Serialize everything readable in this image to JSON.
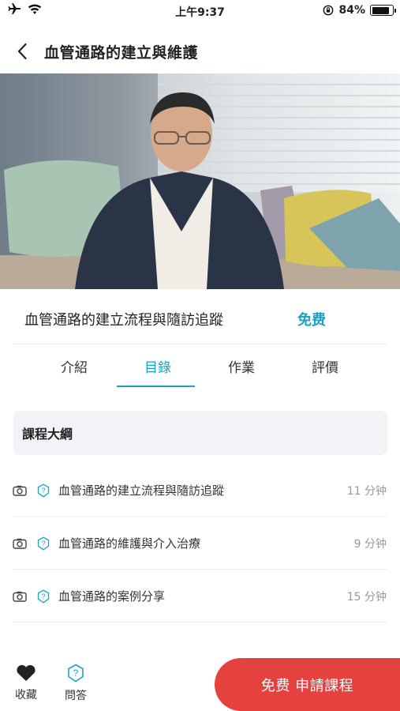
{
  "status_bar": {
    "time": "上午9:37",
    "battery_text": "84%",
    "battery_level": 0.84
  },
  "header": {
    "title": "血管通路的建立與維護",
    "back_icon": "chevron-left-icon"
  },
  "course": {
    "title": "血管通路的建立流程與隨訪追蹤",
    "price": "免费"
  },
  "tabs": [
    {
      "label": "介紹",
      "active": false
    },
    {
      "label": "目錄",
      "active": true
    },
    {
      "label": "作業",
      "active": false
    },
    {
      "label": "評價",
      "active": false
    }
  ],
  "outline": {
    "header": "課程大綱",
    "lessons": [
      {
        "title": "血管通路的建立流程與隨訪追蹤",
        "duration": "11 分钟"
      },
      {
        "title": "血管通路的維護與介入治療",
        "duration": "9 分钟"
      },
      {
        "title": "血管通路的案例分享",
        "duration": "15 分钟"
      }
    ]
  },
  "bottom_bar": {
    "favorite_label": "收藏",
    "qa_label": "問答",
    "apply_label": "免费 申請課程"
  },
  "colors": {
    "accent": "#1aa3c4",
    "cta": "#e5413f"
  }
}
